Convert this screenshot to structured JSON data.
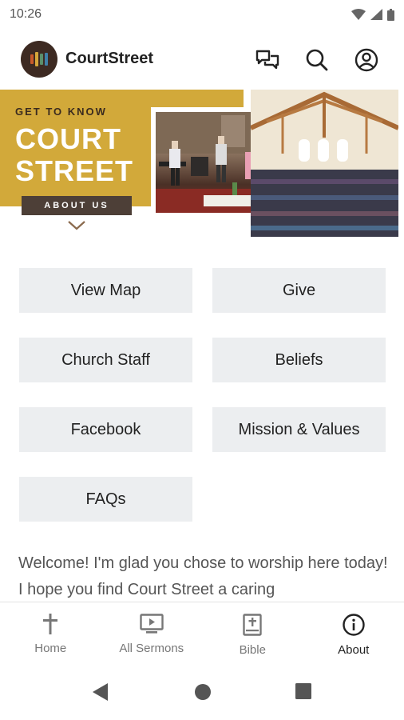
{
  "status_bar": {
    "time": "10:26"
  },
  "app": {
    "title": "CourtStreet"
  },
  "app_actions": [
    "messages-icon",
    "search-icon",
    "account-icon"
  ],
  "hero": {
    "eyebrow": "GET TO KNOW",
    "title_line1": "COURT",
    "title_line2": "STREET",
    "about_button": "ABOUT US",
    "accent_color": "#d2a93a"
  },
  "tiles": [
    {
      "label": "View Map"
    },
    {
      "label": "Give"
    },
    {
      "label": "Church Staff"
    },
    {
      "label": "Beliefs"
    },
    {
      "label": "Facebook"
    },
    {
      "label": "Mission & Values"
    },
    {
      "label": "FAQs"
    }
  ],
  "welcome_text": "Welcome! I'm glad you chose to worship here today! I hope you find Court Street a caring",
  "bottom_nav": [
    {
      "label": "Home",
      "icon": "cross-icon",
      "active": false
    },
    {
      "label": "All Sermons",
      "icon": "monitor-play-icon",
      "active": false
    },
    {
      "label": "Bible",
      "icon": "bible-icon",
      "active": false
    },
    {
      "label": "About",
      "icon": "info-icon",
      "active": true
    }
  ]
}
